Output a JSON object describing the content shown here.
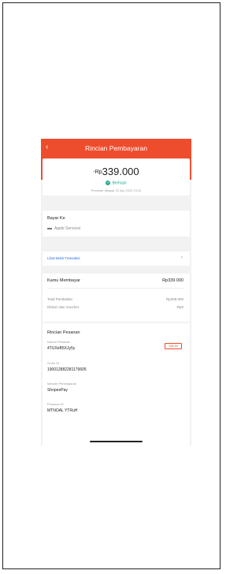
{
  "header": {
    "title": "Rincian Pembayaran",
    "back_icon": "chevron-left-icon"
  },
  "summary": {
    "amount_prefix": "-Rp",
    "amount": "339.000",
    "status": "Berhasil",
    "timestamp": "Pesanan dibayar 22 Apr 2023 13:12"
  },
  "payee": {
    "title": "Bayar Ke",
    "name": "Apple Services"
  },
  "transfer": {
    "label": "Lihat Bukti Transaksi"
  },
  "payment": {
    "title": "Kamu Membayar",
    "total": "Rp339.000",
    "rows": [
      {
        "label": "Total Pembelian",
        "value": "Rp339.000"
      },
      {
        "label": "Diskon dan Voucher",
        "value": "-Rp0"
      }
    ]
  },
  "order": {
    "title": "Rincian Pesanan",
    "copy_label": "SALIN",
    "fields": [
      {
        "label": "Nomor Pesanan",
        "value": "4TUXeB5XJy5y"
      },
      {
        "label": "Order ID",
        "value": "190012882281179605"
      },
      {
        "label": "Metode Pembayaran",
        "value": "ShopeePay"
      },
      {
        "label": "Pesanan ID",
        "value": "MTNOAL YTRuH"
      }
    ]
  },
  "colors": {
    "accent": "#ee4d2d",
    "success": "#26aa99",
    "link": "#2a6bd8"
  }
}
